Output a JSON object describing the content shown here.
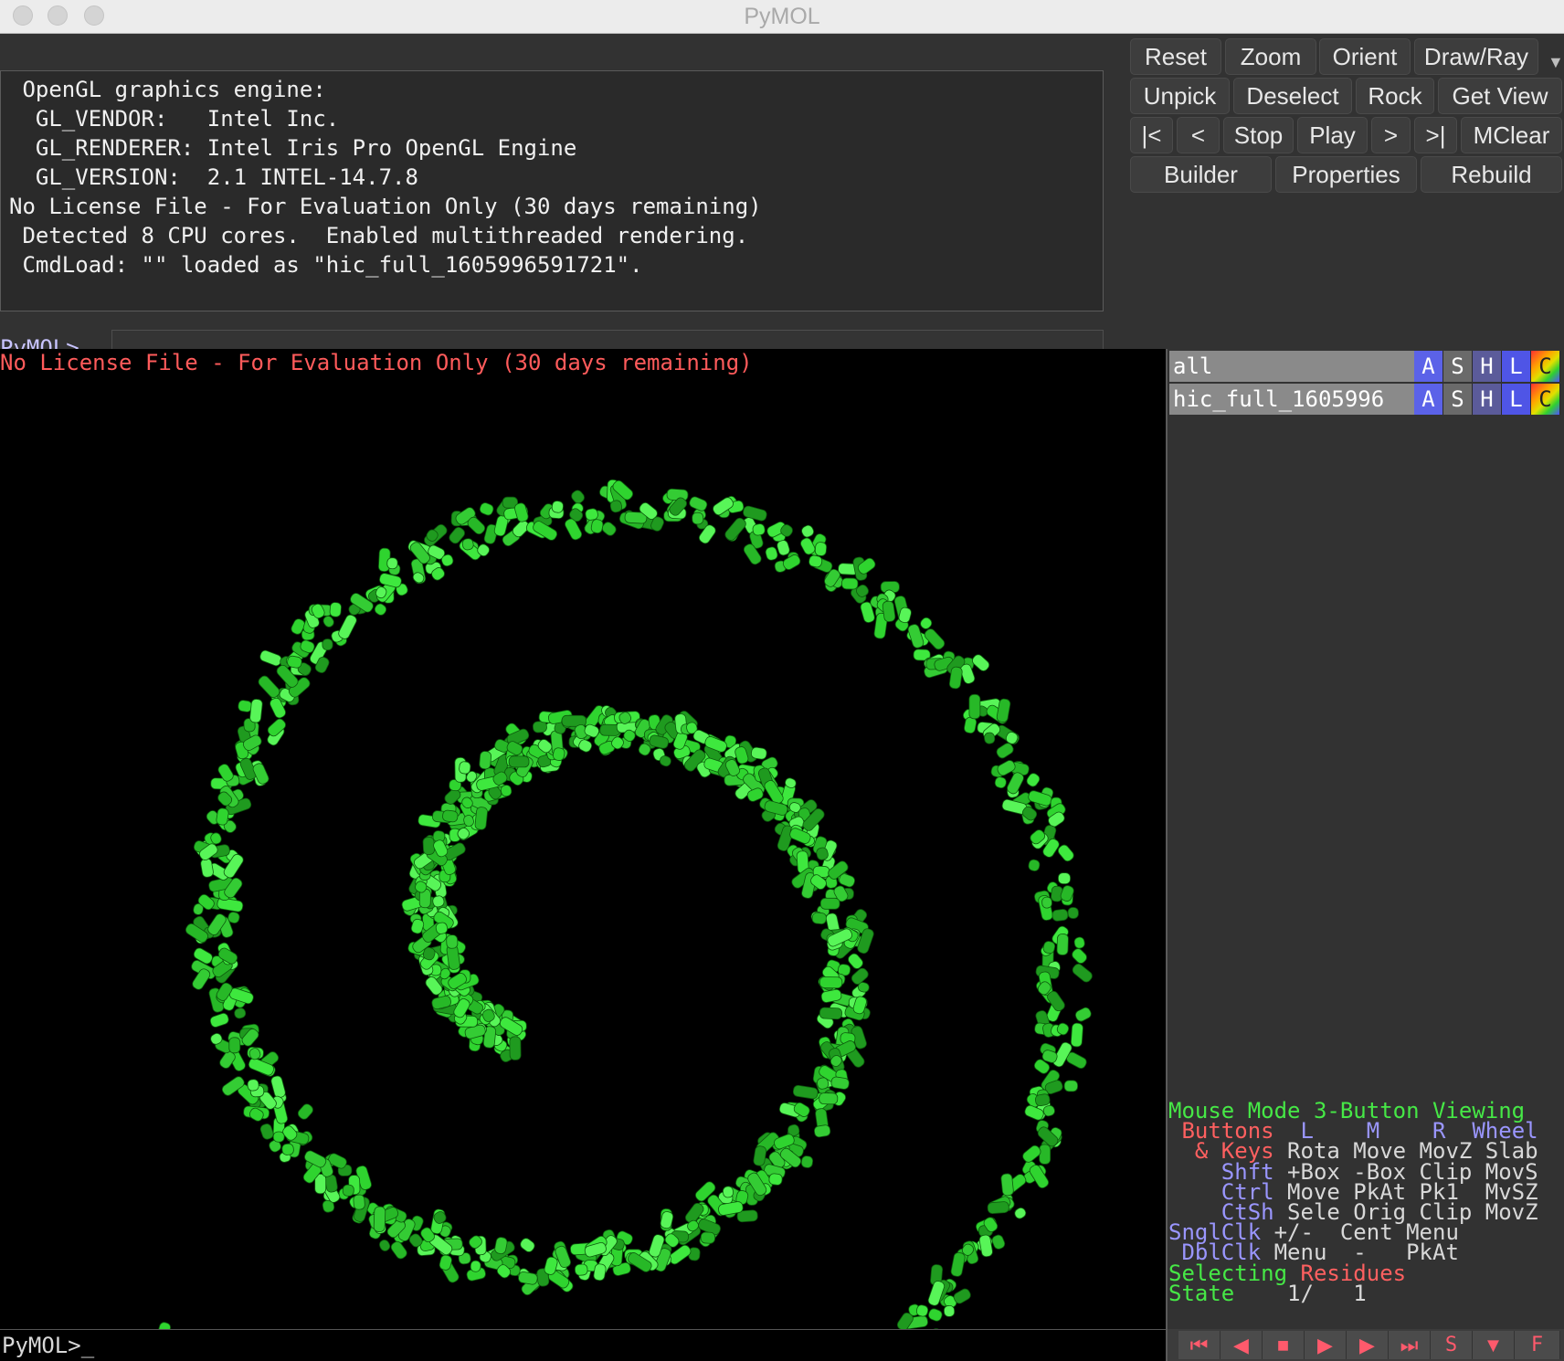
{
  "window": {
    "title": "PyMOL"
  },
  "console": {
    "lines": [
      " OpenGL graphics engine:",
      "  GL_VENDOR:   Intel Inc.",
      "  GL_RENDERER: Intel Iris Pro OpenGL Engine",
      "  GL_VERSION:  2.1 INTEL-14.7.8",
      "No License File - For Evaluation Only (30 days remaining)",
      " Detected 8 CPU cores.  Enabled multithreaded rendering.",
      " CmdLoad: \"\" loaded as \"hic_full_1605996591721\"."
    ]
  },
  "command": {
    "prompt": "PyMOL>",
    "value": ""
  },
  "toolbar": {
    "reset": "Reset",
    "zoom": "Zoom",
    "orient": "Orient",
    "draw_ray": "Draw/Ray",
    "unpick": "Unpick",
    "deselect": "Deselect",
    "rock": "Rock",
    "get_view": "Get View",
    "first": "|<",
    "prev": "<",
    "stop": "Stop",
    "play": "Play",
    "next": ">",
    "last": ">|",
    "mclear": "MClear",
    "builder": "Builder",
    "properties": "Properties",
    "rebuild": "Rebuild"
  },
  "viewport": {
    "notice": "No License File - For Evaluation Only (30 days remaining)",
    "structure_color": "#2fd42f"
  },
  "objects": [
    {
      "name": "all",
      "buttons": [
        "A",
        "S",
        "H",
        "L",
        "C"
      ]
    },
    {
      "name": "hic_full_1605996",
      "buttons": [
        "A",
        "S",
        "H",
        "L",
        "C"
      ]
    }
  ],
  "mouse_mode": {
    "title": "Mouse Mode 3-Button Viewing",
    "buttons_label": " Buttons",
    "col_l": "L",
    "col_m": "M",
    "col_r": "R",
    "col_wheel": "Wheel",
    "keys_label": "  & Keys",
    "keys_vals": "Rota Move MovZ Slab",
    "shft_label": "Shft",
    "shft_vals": "+Box -Box Clip MovS",
    "ctrl_label": "Ctrl",
    "ctrl_vals": "Move PkAt Pk1  MvSZ",
    "ctsh_label": "CtSh",
    "ctsh_vals": "Sele Orig Clip MovZ",
    "sngl_label": "SnglClk",
    "sngl_vals": "+/-  Cent Menu",
    "dbl_label": "DblClk",
    "dbl_vals": "Menu  -   PkAt",
    "selecting_label": "Selecting",
    "selecting_value": "Residues",
    "state_label": "State",
    "state_value": "1/   1"
  },
  "bottom_prompt": "PyMOL>_",
  "player": {
    "rewind": "⏮",
    "back": "◀",
    "stop": "■",
    "play": "▶",
    "forward": "▶",
    "end": "⏭",
    "s": "S",
    "down": "▼",
    "f": "F"
  }
}
